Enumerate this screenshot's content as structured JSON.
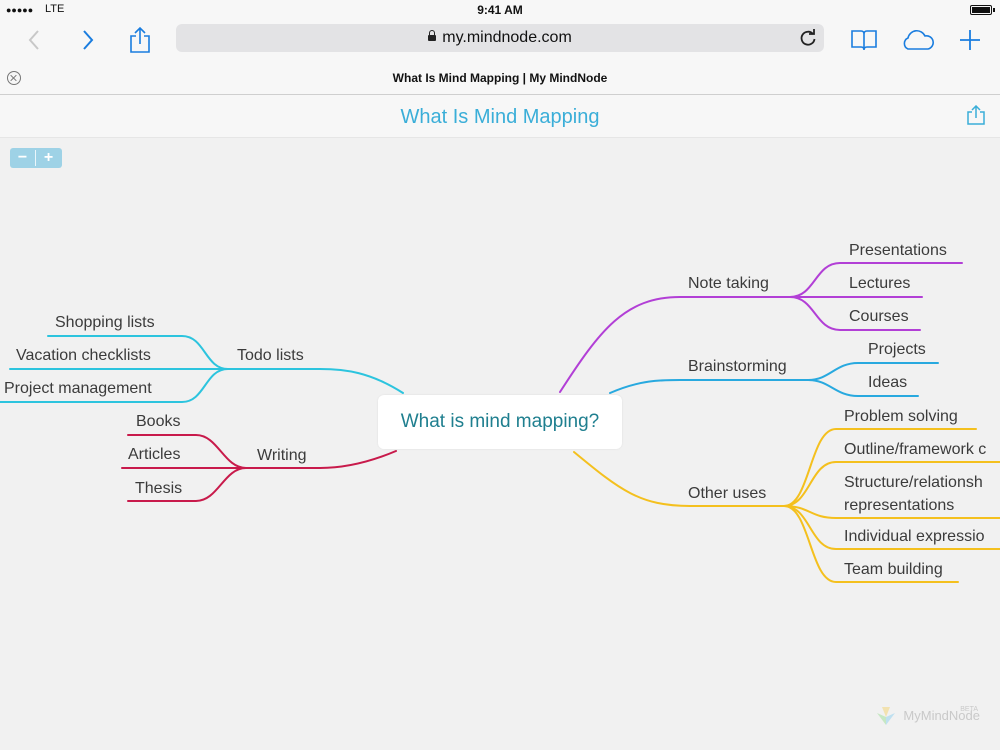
{
  "status_bar": {
    "signal": "●●●●●",
    "carrier": "LTE",
    "time": "9:41 AM"
  },
  "browser": {
    "url": "my.mindnode.com",
    "tab_title": "What Is Mind Mapping | My MindNode"
  },
  "page": {
    "title": "What Is Mind Mapping"
  },
  "zoom": {
    "out_label": "−",
    "in_label": "+"
  },
  "mindmap": {
    "root": "What is mind mapping?",
    "colors": {
      "purple": "#b23fd6",
      "blue": "#28a9df",
      "yellow": "#f4c01e",
      "cyan": "#2cc4de",
      "red": "#c81a4b"
    },
    "branches": {
      "note_taking": {
        "label": "Note taking",
        "children": [
          "Presentations",
          "Lectures",
          "Courses"
        ]
      },
      "brainstorming": {
        "label": "Brainstorming",
        "children": [
          "Projects",
          "Ideas"
        ]
      },
      "other_uses": {
        "label": "Other uses",
        "children": [
          "Problem solving",
          "Outline/framework c",
          "Structure/relationsh",
          "representations",
          "Individual expressio",
          "Team building"
        ]
      },
      "todo_lists": {
        "label": "Todo lists",
        "children": [
          "Shopping lists",
          "Vacation checklists",
          "Project management"
        ]
      },
      "writing": {
        "label": "Writing",
        "children": [
          "Books",
          "Articles",
          "Thesis"
        ]
      }
    }
  },
  "watermark": {
    "brand": "MyMindNode",
    "beta": "BETA"
  }
}
